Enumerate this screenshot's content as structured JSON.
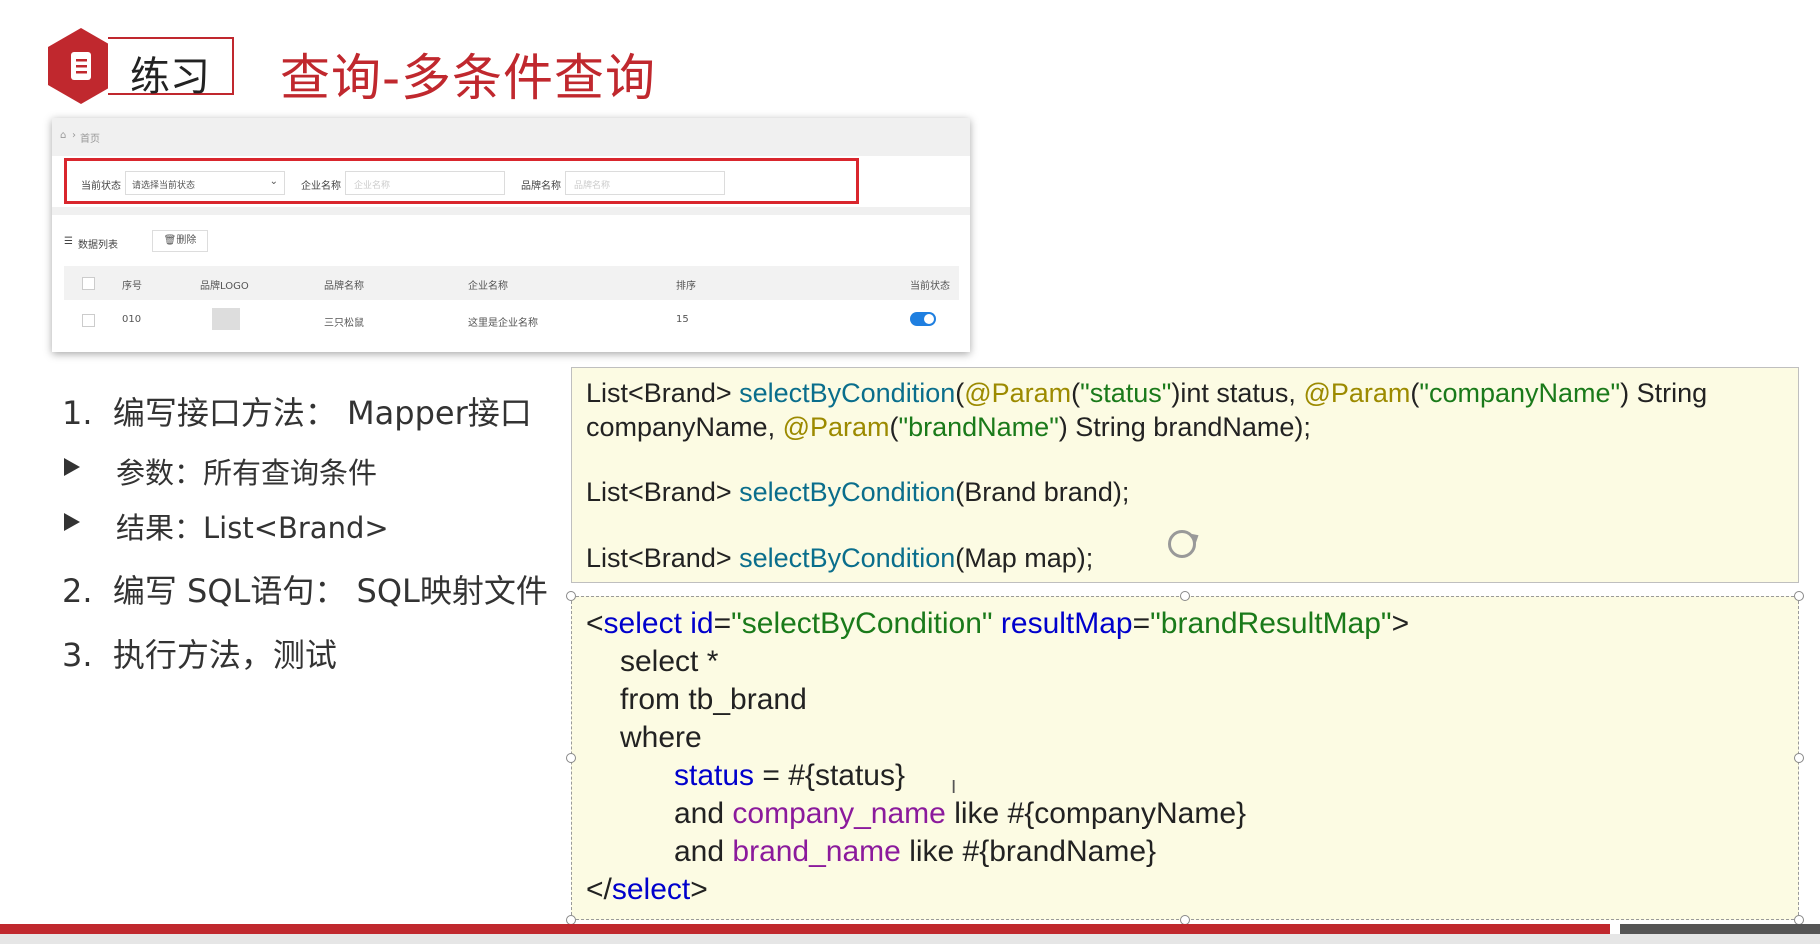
{
  "header": {
    "badge_label": "练习",
    "title": "查询-多条件查询"
  },
  "mock": {
    "breadcrumb_home": "首页",
    "status_label": "当前状态",
    "status_select": "请选择当前状态",
    "company_label": "企业名称",
    "company_placeholder": "企业名称",
    "brand_label": "品牌名称",
    "brand_placeholder": "品牌名称",
    "list_title": "数据列表",
    "delete_label": "删除",
    "columns": [
      "序号",
      "品牌LOGO",
      "品牌名称",
      "企业名称",
      "排序",
      "当前状态"
    ],
    "row": {
      "id": "010",
      "brand": "三只松鼠",
      "company": "这里是企业名称",
      "order": "15"
    }
  },
  "steps": [
    {
      "num": "1.",
      "text": "编写接口方法： Mapper接口"
    },
    {
      "num": "2.",
      "text": "编写 SQL语句： SQL映射文件"
    },
    {
      "num": "3.",
      "text": "执行方法，测试"
    }
  ],
  "sub_items": [
    {
      "text": "参数：所有查询条件"
    },
    {
      "text": "结果：List<Brand>"
    }
  ],
  "code_top": {
    "l1a": "List<Brand> ",
    "l1b": "selectByCondition",
    "l1c": "(",
    "l1d": "@Param",
    "l1e": "(",
    "l1f": "\"status\"",
    "l1g": ")int status, ",
    "l1h": "@Param",
    "l1i": "(",
    "l1j": "\"companyName\"",
    "l1k": ") String",
    "l2a": "companyName, ",
    "l2b": "@Param",
    "l2c": "(",
    "l2d": "\"brandName\"",
    "l2e": ") String brandName);",
    "l3a": "List<Brand> ",
    "l3b": "selectByCondition",
    "l3c": "(Brand brand);",
    "l4a": "List<Brand> ",
    "l4b": "selectByCondition",
    "l4c": "(Map map);"
  },
  "code_bottom": {
    "l1a": "<",
    "l1b": "select",
    "l1c": " id",
    "l1d": "=",
    "l1e": "\"selectByCondition\"",
    "l1f": " resultMap",
    "l1g": "=",
    "l1h": "\"brandResultMap\"",
    "l1i": ">",
    "l2": "select *",
    "l3": "from tb_brand",
    "l4": "where",
    "l5a": "status",
    "l5b": " = #{status}",
    "l6a": "and ",
    "l6b": "company_name",
    "l6c": " like #{companyName}",
    "l7a": "and ",
    "l7b": "brand_name",
    "l7c": " like #{brandName}",
    "l8a": "</",
    "l8b": "select",
    "l8c": ">"
  },
  "colors": {
    "accent": "#c0282e",
    "code_bg": "#fcfbe3",
    "keyword": "#0000cc",
    "string": "#1a7a1a"
  }
}
